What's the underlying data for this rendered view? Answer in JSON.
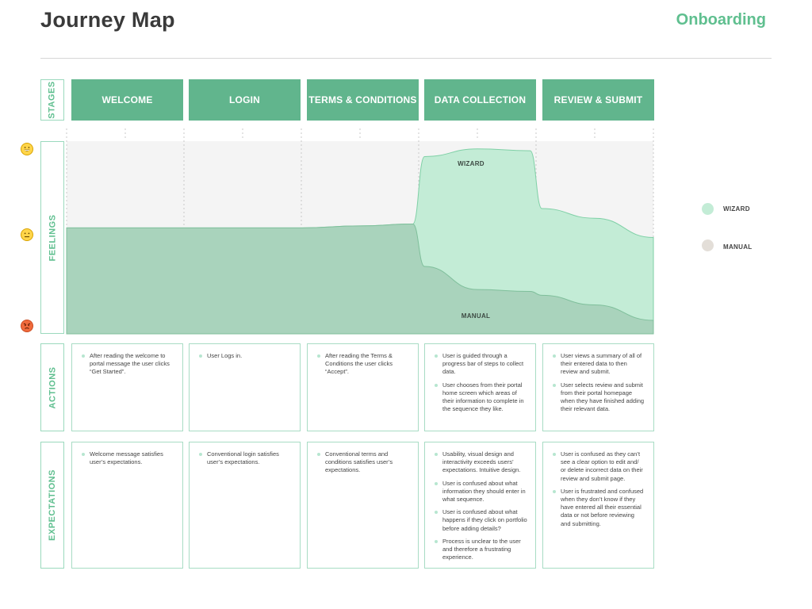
{
  "header": {
    "title": "Journey Map",
    "subtitle": "Onboarding"
  },
  "rows": {
    "stages": "STAGES",
    "feelings": "FEELINGS",
    "actions": "ACTIONS",
    "expectations": "EXPECTATIONS"
  },
  "stages": [
    "WELCOME",
    "LOGIN",
    "TERMS & CONDITIONS",
    "DATA COLLECTION",
    "REVIEW & SUBMIT"
  ],
  "feelings_scale": [
    "grinning-face-icon",
    "neutral-face-icon",
    "angry-face-icon"
  ],
  "legend": [
    {
      "label": "WIZARD",
      "color": "#c3ecd6"
    },
    {
      "label": "MANUAL",
      "color": "#e3ded8"
    }
  ],
  "chart_data": {
    "type": "area",
    "x": [
      0,
      0.5,
      1,
      1.5,
      2,
      2.5,
      2.95,
      3.05,
      3.5,
      3.95,
      4.05,
      4.5,
      5
    ],
    "ylim": [
      0,
      1
    ],
    "series": [
      {
        "name": "WIZARD",
        "color": "#c3ecd6",
        "values": [
          0.55,
          0.55,
          0.55,
          0.55,
          0.55,
          0.56,
          0.57,
          0.92,
          0.96,
          0.95,
          0.65,
          0.6,
          0.5
        ]
      },
      {
        "name": "MANUAL",
        "color": "#a9d3bc",
        "values": [
          0.55,
          0.55,
          0.55,
          0.55,
          0.55,
          0.56,
          0.57,
          0.35,
          0.23,
          0.22,
          0.2,
          0.15,
          0.07
        ]
      }
    ]
  },
  "actions": [
    [
      "After reading the welcome to portal message the user clicks “Get Started”."
    ],
    [
      "User Logs in."
    ],
    [
      "After reading the Terms & Conditions the user clicks “Accept”."
    ],
    [
      "User is guided through a progress bar of steps to collect data.",
      "User chooses from their portal home screen which areas of their information to complete in the sequence they like."
    ],
    [
      "User views a summary of all of their entered data to then review and submit.",
      "User selects review and submit from their portal homepage when they have finished adding their relevant data."
    ]
  ],
  "expectations": [
    [
      "Welcome message satisfies user’s expectations."
    ],
    [
      "Conventional login satisfies user’s expectations."
    ],
    [
      "Conventional terms and conditions satisfies user’s expectations."
    ],
    [
      "Usability, visual design and interactivity exceeds users’ expectations. Intuitive design.",
      "User is confused about what information they should enter in what sequence.",
      "User is confused about what happens if they click on portfolio before adding details?",
      "Process is unclear to the user and therefore a frustrating experience."
    ],
    [
      "User is confused as they can’t see a clear option to edit and/ or delete incorrect data on their review and submit page.",
      "User is frustrated and confused when they don’t know if they have  entered all their essential data or not before reviewing and submitting."
    ]
  ]
}
